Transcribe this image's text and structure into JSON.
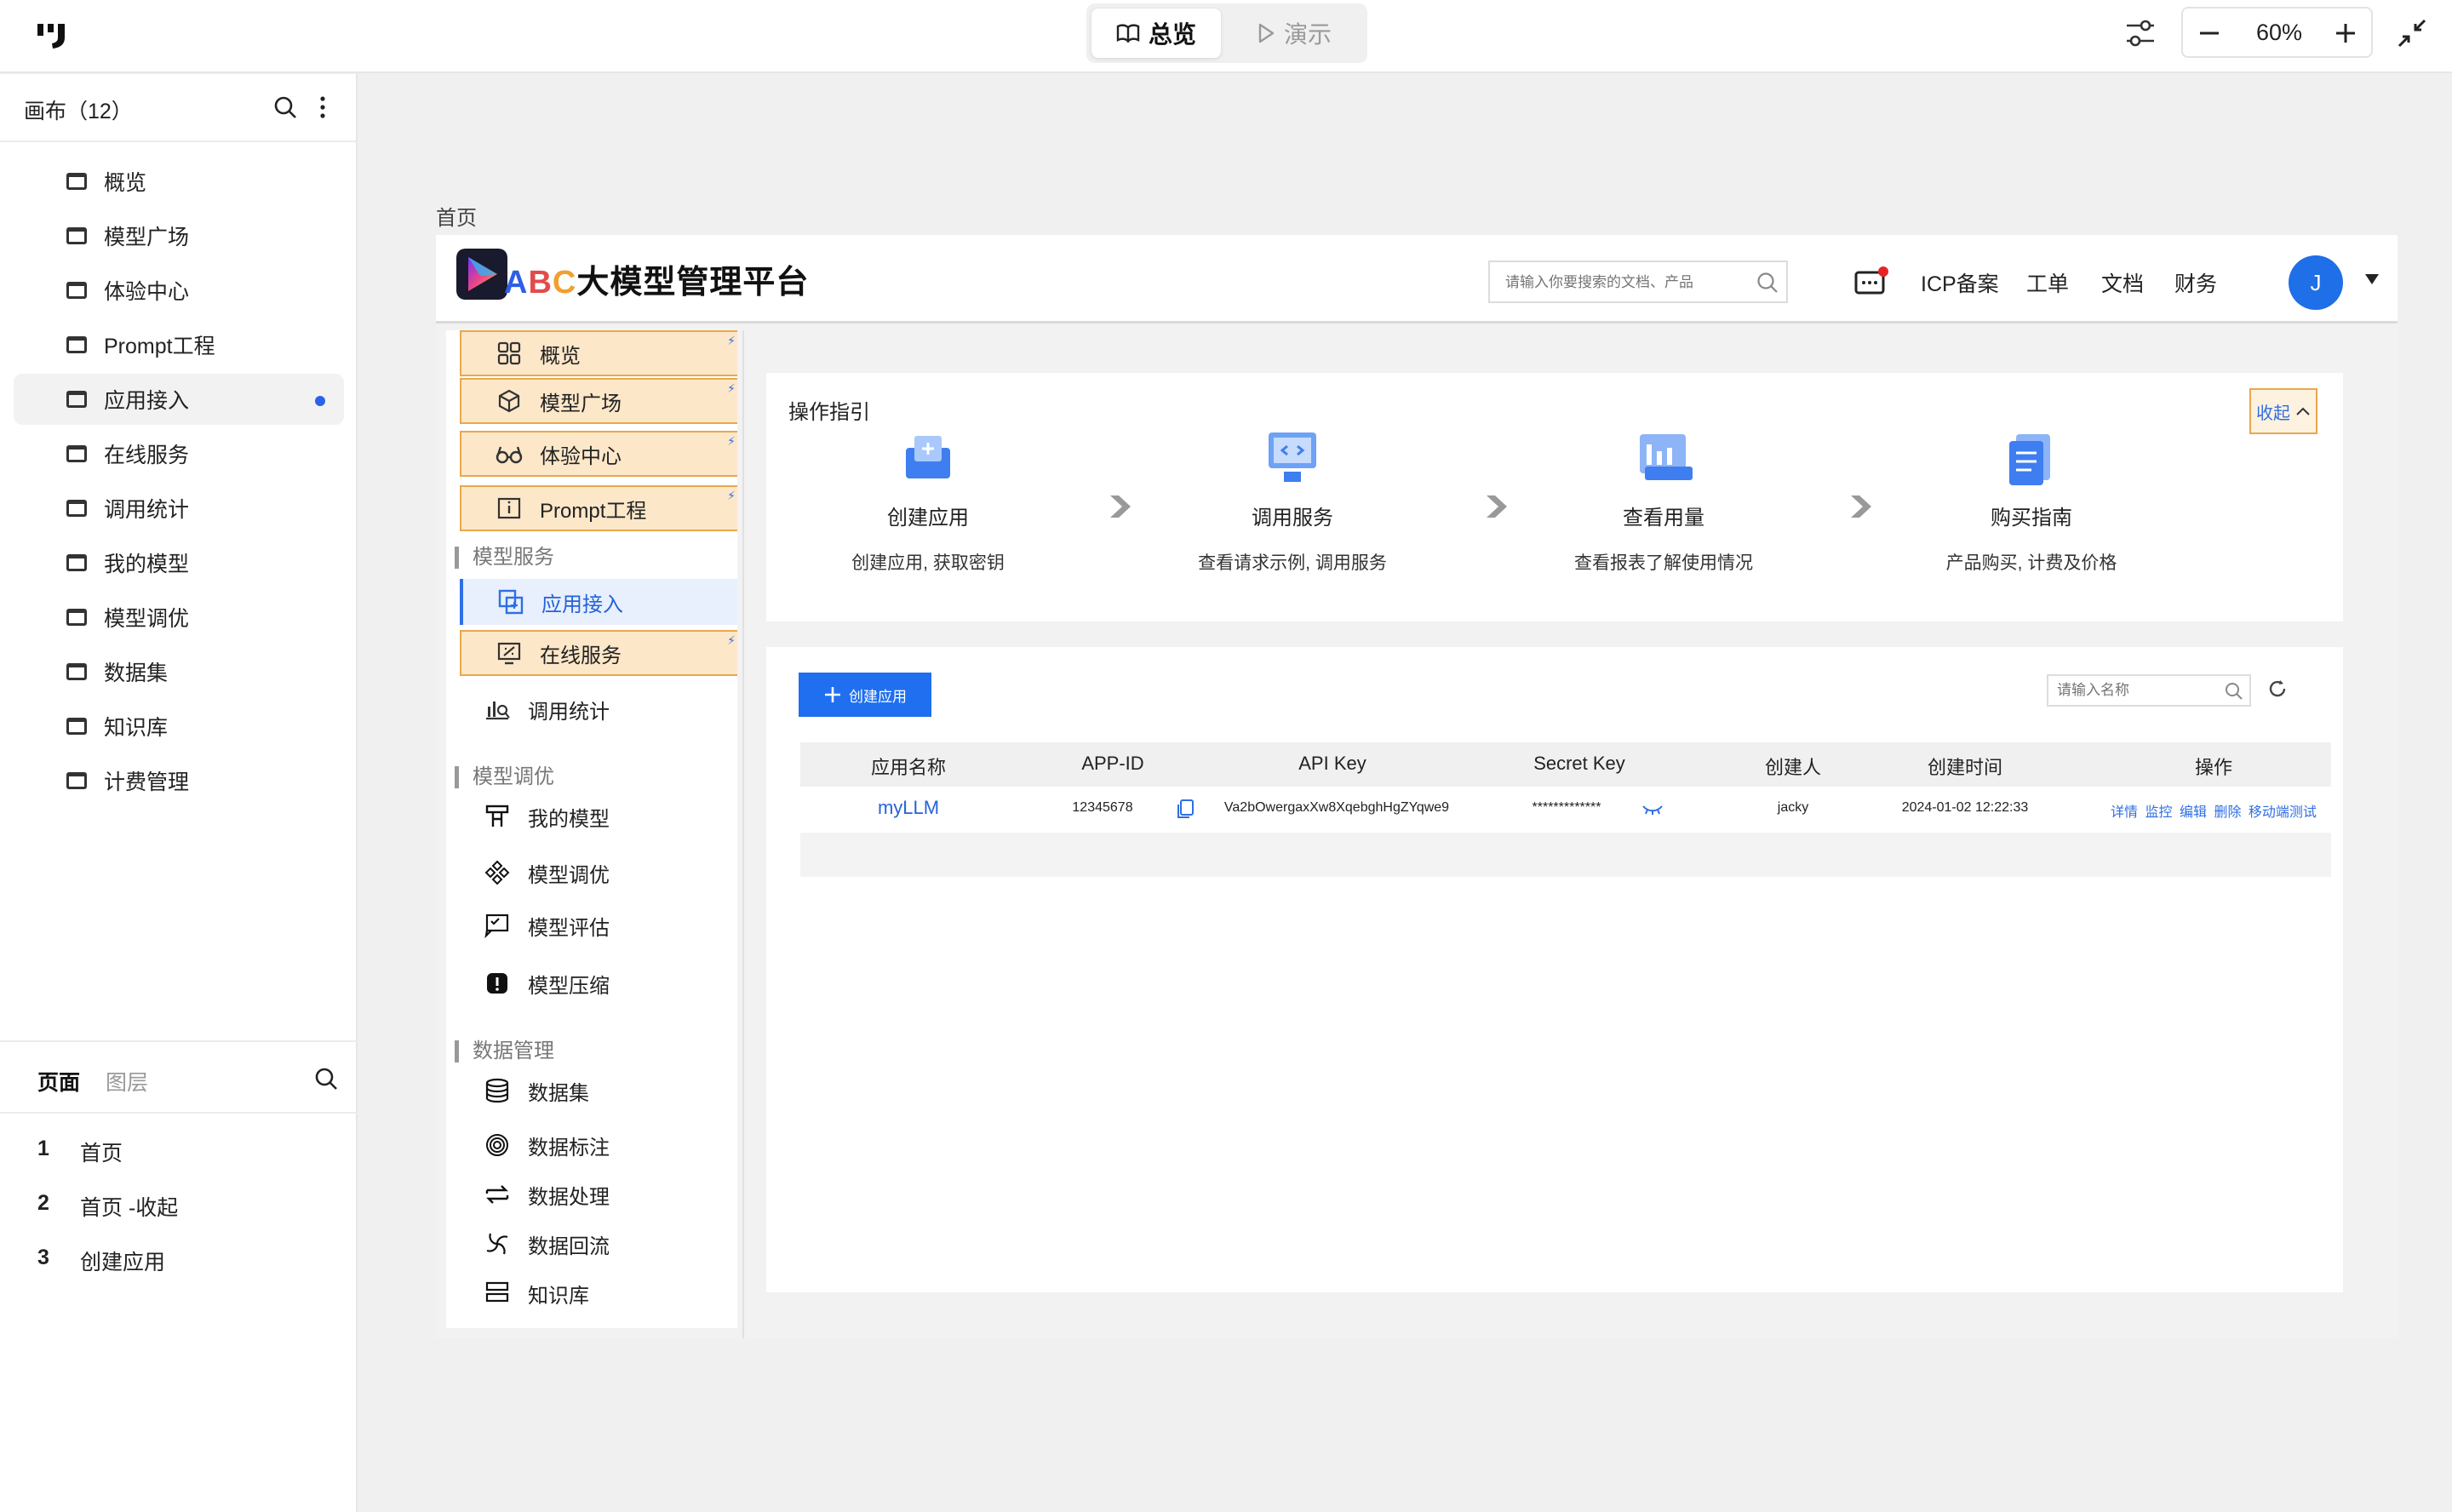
{
  "toolbar": {
    "overview_label": "总览",
    "present_label": "演示",
    "zoom": "60%"
  },
  "canvas": {
    "title": "画布（12）",
    "items": [
      {
        "label": "概览",
        "active": false
      },
      {
        "label": "模型广场",
        "active": false
      },
      {
        "label": "体验中心",
        "active": false
      },
      {
        "label": "Prompt工程",
        "active": false
      },
      {
        "label": "应用接入",
        "active": true
      },
      {
        "label": "在线服务",
        "active": false
      },
      {
        "label": "调用统计",
        "active": false
      },
      {
        "label": "我的模型",
        "active": false
      },
      {
        "label": "模型调优",
        "active": false
      },
      {
        "label": "数据集",
        "active": false
      },
      {
        "label": "知识库",
        "active": false
      },
      {
        "label": "计费管理",
        "active": false
      }
    ]
  },
  "pages_panel": {
    "tab_pages": "页面",
    "tab_layers": "图层",
    "pages": [
      {
        "num": "1",
        "label": "首页"
      },
      {
        "num": "2",
        "label": "首页 -收起"
      },
      {
        "num": "3",
        "label": "创建应用"
      }
    ]
  },
  "artboard": {
    "label": "首页"
  },
  "app": {
    "brand_abc": [
      "A",
      "B",
      "C"
    ],
    "brand_rest": "大模型管理平台",
    "search_placeholder": "请输入你要搜索的文档、产品",
    "links": [
      "ICP备案",
      "工单",
      "文档",
      "财务"
    ],
    "avatar": "J",
    "sidebar": {
      "top": [
        "概览",
        "模型广场",
        "体验中心",
        "Prompt工程"
      ],
      "group1": "模型服务",
      "group1_items": [
        "应用接入",
        "在线服务",
        "调用统计"
      ],
      "group2": "模型调优",
      "group2_items": [
        "我的模型",
        "模型调优",
        "模型评估",
        "模型压缩"
      ],
      "group3": "数据管理",
      "group3_items": [
        "数据集",
        "数据标注",
        "数据处理",
        "数据回流",
        "知识库"
      ]
    },
    "guide": {
      "title": "操作指引",
      "collapse": "收起",
      "steps": [
        {
          "title": "创建应用",
          "desc": "创建应用, 获取密钥"
        },
        {
          "title": "调用服务",
          "desc": "查看请求示例, 调用服务"
        },
        {
          "title": "查看用量",
          "desc": "查看报表了解使用情况"
        },
        {
          "title": "购买指南",
          "desc": "产品购买, 计费及价格"
        }
      ]
    },
    "table": {
      "create_btn": "创建应用",
      "search_placeholder": "请输入名称",
      "columns": [
        "应用名称",
        "APP-ID",
        "API Key",
        "Secret Key",
        "创建人",
        "创建时间",
        "操作"
      ],
      "row": {
        "name": "myLLM",
        "app_id": "12345678",
        "api_key": "Va2bOwergaxXw8XqebghHgZYqwe9",
        "secret": "*************",
        "creator": "jacky",
        "created": "2024-01-02 12:22:33",
        "ops": [
          "详情",
          "监控",
          "编辑",
          "删除",
          "移动端测试"
        ]
      }
    }
  }
}
